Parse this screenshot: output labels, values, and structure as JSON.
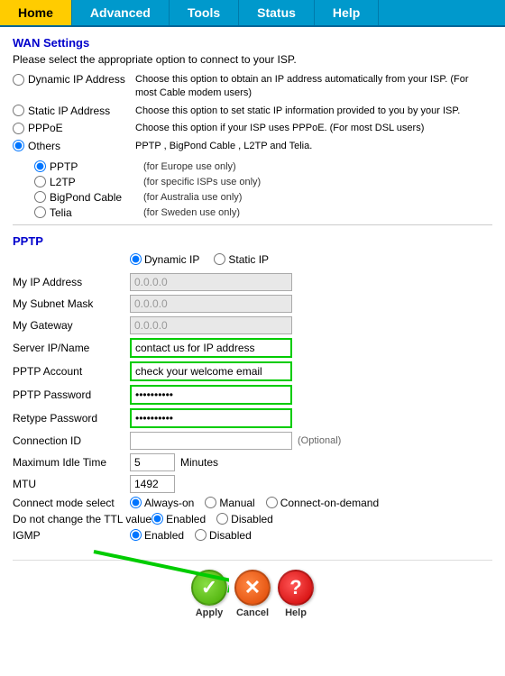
{
  "nav": {
    "items": [
      "Home",
      "Advanced",
      "Tools",
      "Status",
      "Help"
    ],
    "active": "Home"
  },
  "wan": {
    "section_title": "WAN Settings",
    "intro": "Please select the appropriate option to connect to your ISP.",
    "options": [
      {
        "id": "dynamic",
        "label": "Dynamic IP Address",
        "desc": "Choose this option to obtain an IP address automatically from your ISP. (For most Cable modem users)"
      },
      {
        "id": "static",
        "label": "Static IP Address",
        "desc": "Choose this option to set static IP information provided to you by your ISP."
      },
      {
        "id": "pppoe",
        "label": "PPPoE",
        "desc": "Choose this option if your ISP uses PPPoE. (For most DSL users)"
      },
      {
        "id": "others",
        "label": "Others",
        "desc": "PPTP , BigPond Cable , L2TP and Telia."
      }
    ],
    "sub_options": [
      {
        "id": "pptp",
        "label": "PPTP",
        "desc": "(for Europe use only)"
      },
      {
        "id": "l2tp",
        "label": "L2TP",
        "desc": "(for specific ISPs use only)"
      },
      {
        "id": "bigpond",
        "label": "BigPond Cable",
        "desc": "(for Australia use only)"
      },
      {
        "id": "telia",
        "label": "Telia",
        "desc": "(for Sweden use only)"
      }
    ]
  },
  "pptp": {
    "section_title": "PPTP",
    "ip_types": [
      "Dynamic IP",
      "Static IP"
    ],
    "selected_ip_type": "Dynamic IP",
    "fields": [
      {
        "label": "My IP Address",
        "value": "0.0.0.0",
        "type": "disabled",
        "id": "my-ip"
      },
      {
        "label": "My Subnet Mask",
        "value": "0.0.0.0",
        "type": "disabled",
        "id": "subnet"
      },
      {
        "label": "My Gateway",
        "value": "0.0.0.0",
        "type": "disabled",
        "id": "gateway"
      },
      {
        "label": "Server IP/Name",
        "value": "contact us for IP address",
        "type": "highlighted",
        "id": "server-ip"
      },
      {
        "label": "PPTP Account",
        "value": "check your welcome email",
        "type": "highlighted",
        "id": "pptp-account"
      },
      {
        "label": "PPTP Password",
        "value": "••••••••••",
        "type": "password",
        "id": "pptp-password"
      },
      {
        "label": "Retype Password",
        "value": "••••••••••",
        "type": "password",
        "id": "retype-password"
      },
      {
        "label": "Connection ID",
        "value": "",
        "type": "normal",
        "suffix": "(Optional)",
        "id": "connection-id"
      },
      {
        "label": "Maximum Idle Time",
        "value": "5",
        "type": "small",
        "suffix": "Minutes",
        "id": "idle-time"
      },
      {
        "label": "MTU",
        "value": "1492",
        "type": "small-normal",
        "id": "mtu"
      }
    ],
    "connect_mode": {
      "label": "Connect mode select",
      "options": [
        "Always-on",
        "Manual",
        "Connect-on-demand"
      ],
      "selected": "Always-on"
    },
    "ttl": {
      "label": "Do not change the TTL value",
      "options": [
        "Enabled",
        "Disabled"
      ],
      "selected": "Enabled"
    },
    "igmp": {
      "label": "IGMP",
      "options": [
        "Enabled",
        "Disabled"
      ],
      "selected": "Enabled"
    }
  },
  "buttons": {
    "apply": "Apply",
    "cancel": "Cancel",
    "help": "Help"
  }
}
